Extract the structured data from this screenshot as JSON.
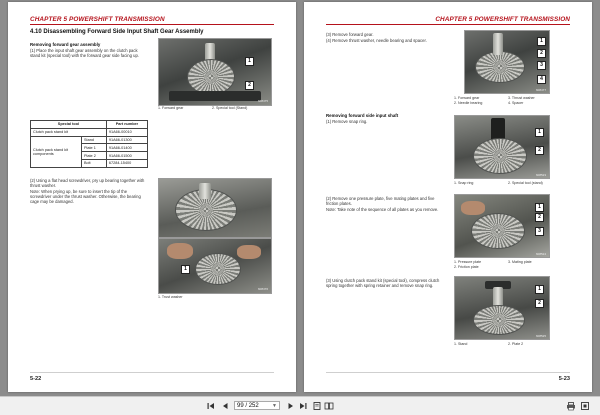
{
  "left_page": {
    "chapter": "CHAPTER 5 POWERSHIFT TRANSMISSION",
    "section_title": "4.10    Disassembling Forward Side Input Shaft Gear Assembly",
    "sub_title": "Removing forward gear assembly",
    "step1": "(1)  Place the input shaft gear assembly on the clutch pack stand kit (special tool) with the forward gear side facing up.",
    "fig1": {
      "id": "608475",
      "callout1": "1",
      "callout2": "2",
      "caption1": "1. Forward gear",
      "caption2": "2. Special tool (Stand)"
    },
    "table": {
      "headers": [
        "Special tool",
        "Part number"
      ],
      "rows": [
        {
          "tool": "Clutch pack stand kit",
          "sub": "",
          "part": "91A66-00010"
        },
        {
          "tool": "Clutch pack stand kit components",
          "sub": "Stand",
          "part": "91A66-01300"
        },
        {
          "tool": "",
          "sub": "Plate 1",
          "part": "91A66-01400"
        },
        {
          "tool": "",
          "sub": "Plate 2",
          "part": "91A66-01500"
        },
        {
          "tool": "",
          "sub": "Bolt",
          "part": "67284-15400"
        }
      ]
    },
    "step2": "(2)  Using a flat head screwdriver, pry up bearing together with thrust washer.",
    "note": "Note: When prying up, be sure to insert the tip of the screwdriver under the thrust washer. Otherwise, the bearing cage may be damaged.",
    "fig2": {
      "id": "608476",
      "callout1": "1",
      "caption1": "1. Trust washer"
    },
    "page_number": "5-22"
  },
  "right_page": {
    "chapter": "CHAPTER 5 POWERSHIFT TRANSMISSION",
    "step3": "(3)  Remove forward gear.",
    "step4": "(4)  Remove thrust washer, needle bearing and spacer.",
    "fig3": {
      "id": "608477",
      "callouts": [
        "1",
        "2",
        "3",
        "4"
      ],
      "caption1": "1. Forward gear",
      "caption2": "2. Needle bearing",
      "caption3": "3. Thrust washer",
      "caption4": "4. Spacer"
    },
    "sub_title": "Removing forward side input shaft",
    "step_r1": "(1)  Remove snap ring.",
    "fig4": {
      "id": "608523",
      "callouts": [
        "1",
        "2"
      ],
      "caption1": "1. Snap ring",
      "caption2": "2. Special tool (stand)"
    },
    "step_r2": "(2)  Remove one pressure plate, five mating plates and five friction plates.",
    "note_r2": "Note: Take note of the sequence of all plates as you remove.",
    "fig5": {
      "id": "608524",
      "callouts": [
        "1",
        "2",
        "3"
      ],
      "caption1": "1. Pressure plate",
      "caption2": "2. Friction plate",
      "caption3": "3. Mating plate"
    },
    "step_r3": "(3)  Using clutch pack stand kit (special tool), compress clutch spring together with spring retainer and remove snap ring.",
    "fig6": {
      "id": "608525",
      "callouts": [
        "1",
        "2"
      ],
      "caption1": "1. Stand",
      "caption2": "2. Plate 2"
    },
    "page_number": "5-23"
  },
  "toolbar": {
    "current_page": "99",
    "separator": "/",
    "total_pages": "252",
    "first_icon": "first-page-icon",
    "prev_icon": "prev-page-icon",
    "next_icon": "next-page-icon",
    "last_icon": "last-page-icon"
  },
  "colors": {
    "accent": "#b5121b",
    "viewer_bg": "#8c8c8c",
    "toolbar_bg": "#f0f0f0"
  }
}
